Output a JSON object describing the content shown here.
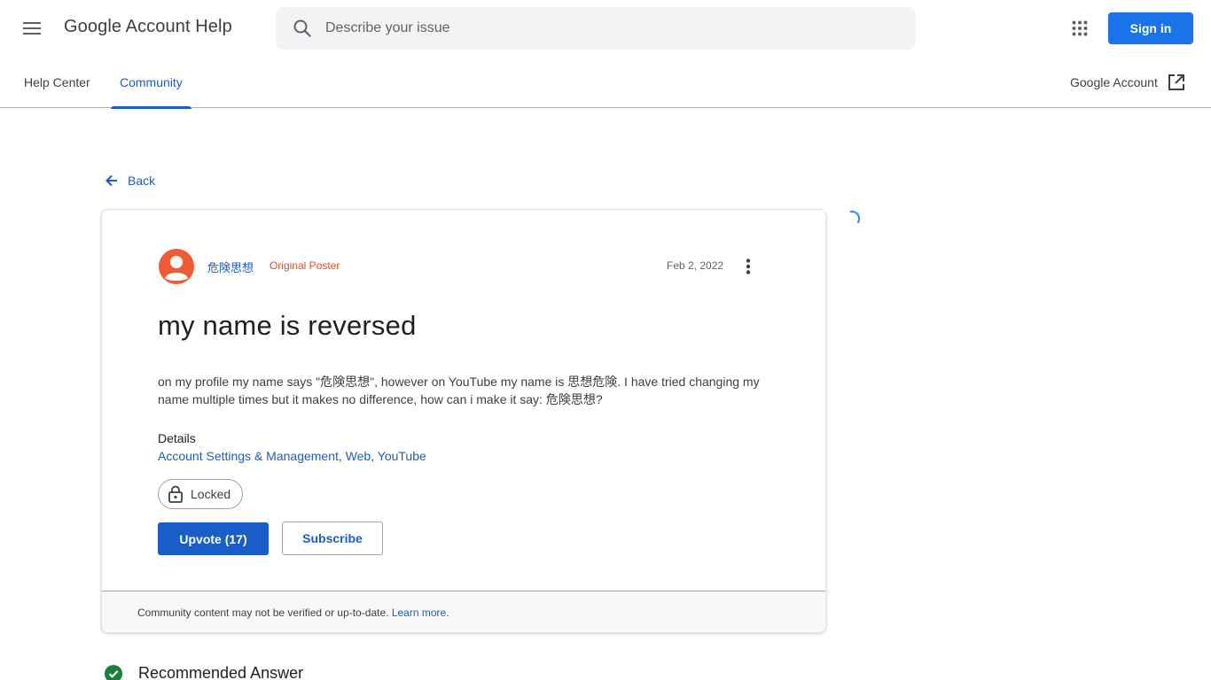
{
  "header": {
    "app_title": "Google Account Help",
    "search_placeholder": "Describe your issue",
    "signin_label": "Sign in",
    "menu_icon": "hamburger-menu-icon",
    "apps_icon": "apps-grid-icon",
    "accent_color": "#1a73e8"
  },
  "tabs": [
    {
      "label": "Help Center",
      "active": false
    },
    {
      "label": "Community",
      "active": true
    }
  ],
  "account_link": {
    "label": "Google Account",
    "icon": "open-in-new-icon"
  },
  "back_label": "Back",
  "post": {
    "author": "危険思想",
    "author_badge": "Original Poster",
    "date": "Feb 2, 2022",
    "title": "my name is reversed",
    "body": "on my profile my name says \"危険思想\", however on YouTube my name is 思想危険. I have tried changing my name multiple times but it makes no difference, how can i make it say: 危険思想?",
    "details_label": "Details",
    "details": {
      "tag1": "Account Settings & Management",
      "sep1": ", ",
      "tag2": "Web",
      "sep2": ", ",
      "tag3": "YouTube"
    },
    "status": "Locked",
    "upvote_label": "Upvote (17)",
    "subscribe_label": "Subscribe",
    "avatar_color": "#ef5b34"
  },
  "footer": {
    "notice": "Community content may not be verified or up-to-date. ",
    "link": "Learn more",
    "end": "."
  },
  "recommended": {
    "label": "Recommended Answer",
    "icon": "check-circle-icon",
    "color": "#188038"
  }
}
